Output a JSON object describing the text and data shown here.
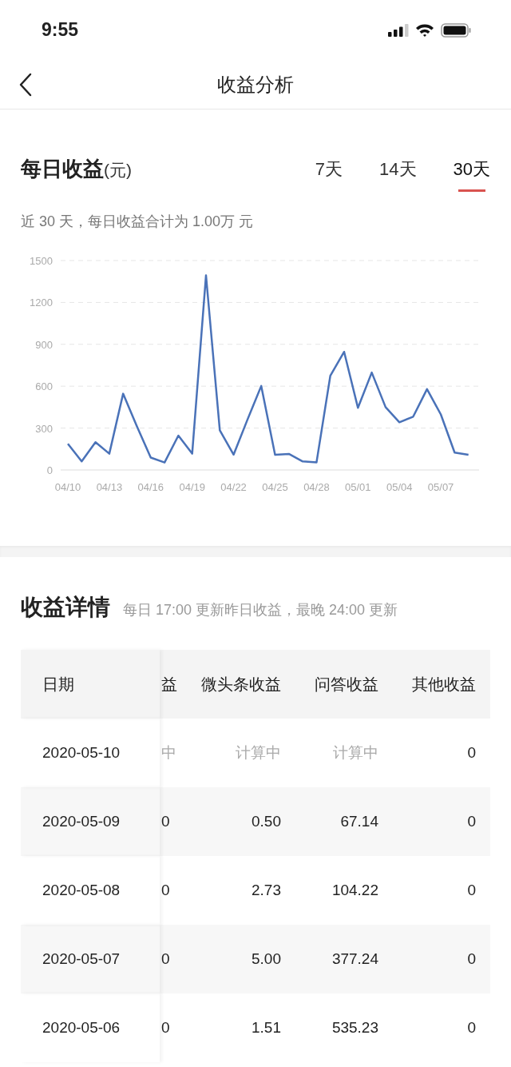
{
  "status_bar": {
    "time": "9:55"
  },
  "nav": {
    "title": "收益分析"
  },
  "daily": {
    "title": "每日收益",
    "unit": "(元)",
    "tabs": [
      {
        "label": "7天",
        "selected": false
      },
      {
        "label": "14天",
        "selected": false
      },
      {
        "label": "30天",
        "selected": true
      }
    ],
    "summary": "近 30 天，每日收益合计为 1.00万 元",
    "chart_data": {
      "type": "line",
      "grid": true,
      "categories": [
        "04/10",
        null,
        null,
        "04/13",
        null,
        null,
        "04/16",
        null,
        null,
        "04/19",
        null,
        null,
        "04/22",
        null,
        null,
        "04/25",
        null,
        null,
        "04/28",
        null,
        null,
        "05/01",
        null,
        null,
        "05/04",
        null,
        null,
        "05/07",
        null,
        null
      ],
      "series": [
        {
          "color": "#4a72b8",
          "values": [
            188,
            61,
            199,
            117,
            546,
            312,
            89,
            54,
            246,
            117,
            1394,
            284,
            110,
            360,
            602,
            108,
            115,
            61,
            54,
            675,
            846,
            445,
            698,
            450,
            342,
            382,
            579,
            398,
            124,
            108
          ]
        }
      ],
      "ylim": [
        0,
        1500
      ],
      "yticks": [
        0,
        300,
        600,
        900,
        1200,
        1500
      ]
    }
  },
  "details": {
    "title": "收益详情",
    "note": "每日 17:00 更新昨日收益，最晚 24:00 更新",
    "table": {
      "columns": [
        "日期",
        "益",
        "微头条收益",
        "问答收益",
        "其他收益"
      ],
      "rows": [
        {
          "cells": [
            "2020-05-10",
            "中",
            "计算中",
            "计算中",
            "0"
          ],
          "pending": [
            false,
            true,
            true,
            true,
            false
          ]
        },
        {
          "cells": [
            "2020-05-09",
            "0",
            "0.50",
            "67.14",
            "0"
          ],
          "pending": [
            false,
            false,
            false,
            false,
            false
          ]
        },
        {
          "cells": [
            "2020-05-08",
            "0",
            "2.73",
            "104.22",
            "0"
          ],
          "pending": [
            false,
            false,
            false,
            false,
            false
          ]
        },
        {
          "cells": [
            "2020-05-07",
            "0",
            "5.00",
            "377.24",
            "0"
          ],
          "pending": [
            false,
            false,
            false,
            false,
            false
          ]
        },
        {
          "cells": [
            "2020-05-06",
            "0",
            "1.51",
            "535.23",
            "0"
          ],
          "pending": [
            false,
            false,
            false,
            false,
            false
          ]
        }
      ]
    }
  }
}
